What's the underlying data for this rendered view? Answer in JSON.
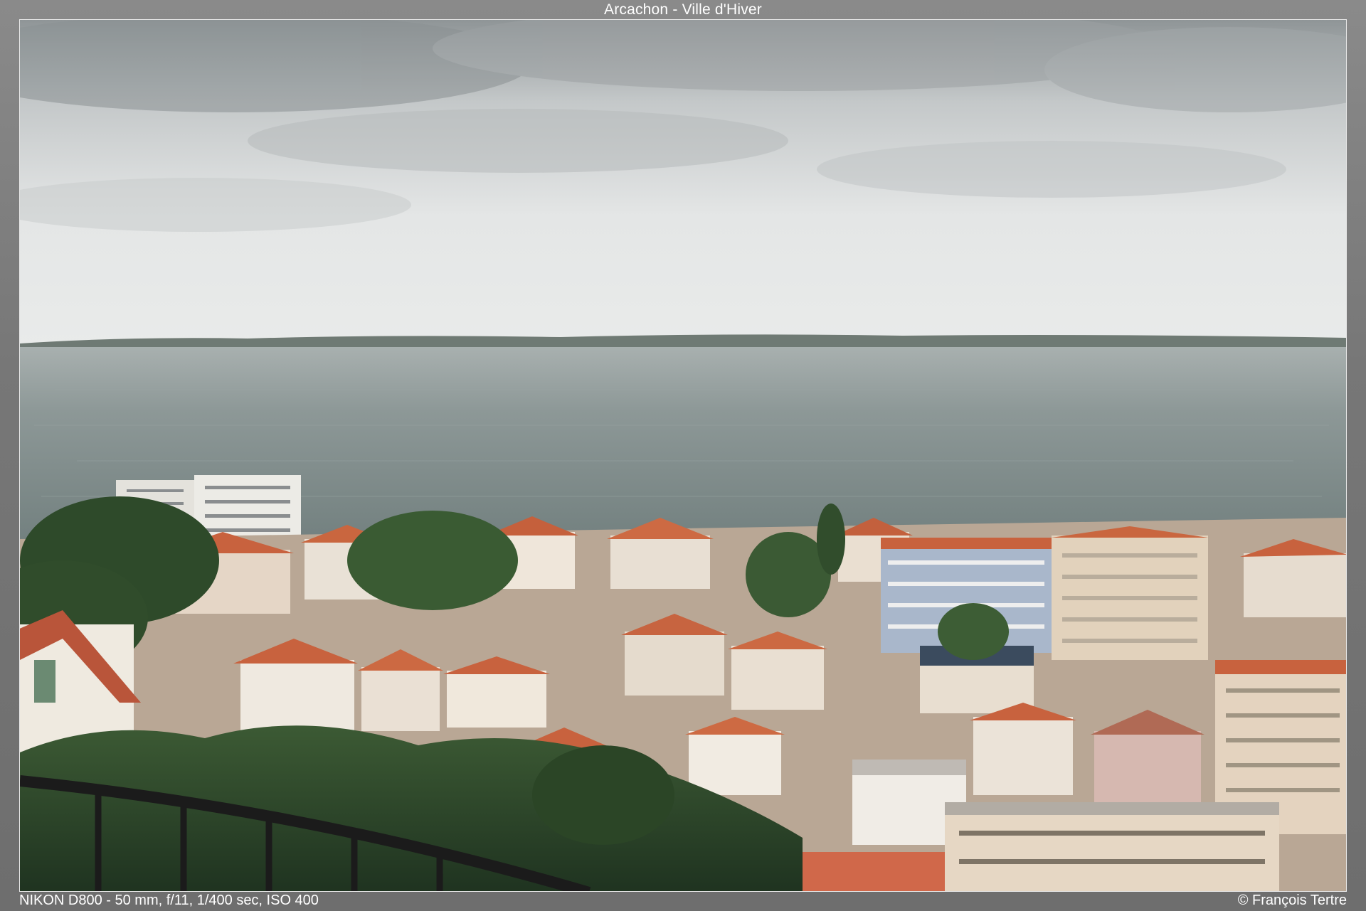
{
  "title": "Arcachon - Ville d'Hiver",
  "exif": "NIKON D800 - 50 mm, f/11, 1/400 sec, ISO 400",
  "copyright": "© François Tertre",
  "colors": {
    "sky": "#d9dcdc",
    "cloud_dark": "#9da3a5",
    "water": "#7f8e8e",
    "roof": "#c8623e",
    "wall": "#e6ddd0",
    "tree": "#2f4a2a",
    "railing": "#1b1b1b"
  }
}
